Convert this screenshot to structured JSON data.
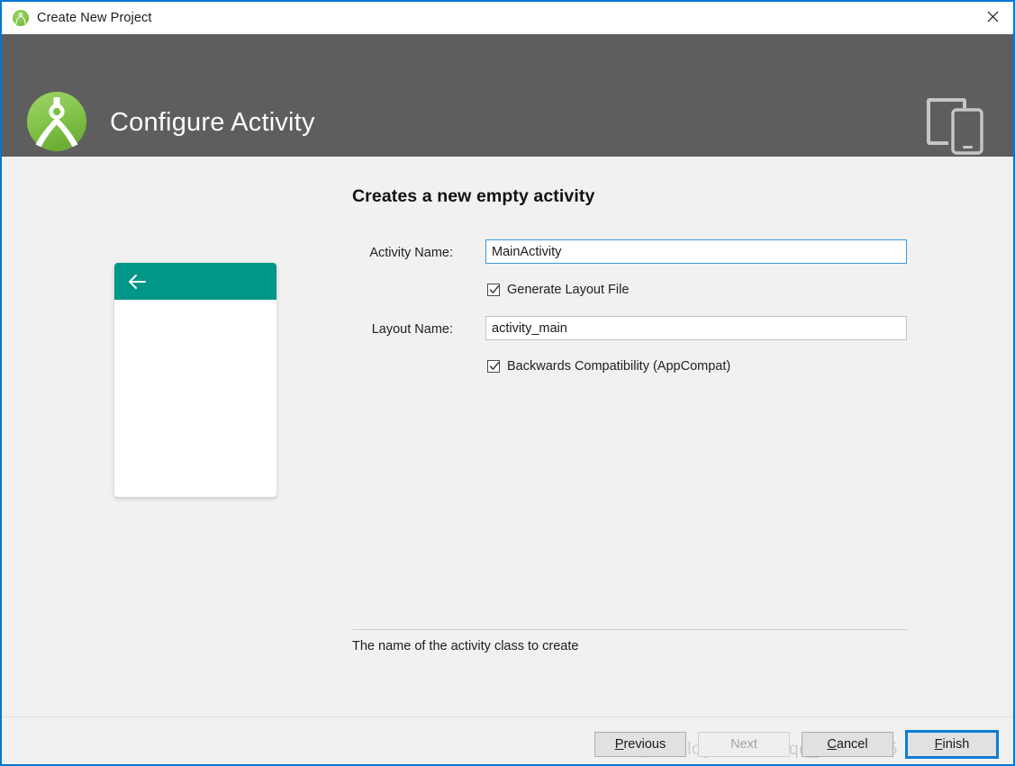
{
  "window": {
    "title": "Create New Project",
    "title_icon": "android-studio-icon",
    "close_icon": "close-icon",
    "accent_border_color": "#0078d7"
  },
  "header": {
    "title": "Configure Activity",
    "logo_icon": "android-studio-logo",
    "devices_icon": "tablet-phone-icon",
    "background_color": "#5e5e5e",
    "text_color": "#fdfdfd"
  },
  "preview": {
    "appbar_color": "#009688",
    "back_icon": "back-arrow-icon"
  },
  "form": {
    "heading": "Creates a new empty activity",
    "activity_name_label": "Activity Name:",
    "activity_name_value": "MainActivity",
    "activity_name_focused": true,
    "generate_layout_label": "Generate Layout File",
    "generate_layout_checked": true,
    "layout_name_label": "Layout Name:",
    "layout_name_value": "activity_main",
    "backwards_compat_label": "Backwards Compatibility (AppCompat)",
    "backwards_compat_checked": true,
    "help_text": "The name of the activity class to create"
  },
  "buttons": {
    "previous": "Previous",
    "previous_mnemonic": "P",
    "next": "Next",
    "next_disabled": true,
    "cancel": "Cancel",
    "cancel_mnemonic": "C",
    "finish": "Finish",
    "finish_mnemonic": "F",
    "finish_is_default": true,
    "default_border_color": "#0c7cd5"
  },
  "watermark": {
    "text": "https://blog.csdn.net/qq_38733275"
  }
}
